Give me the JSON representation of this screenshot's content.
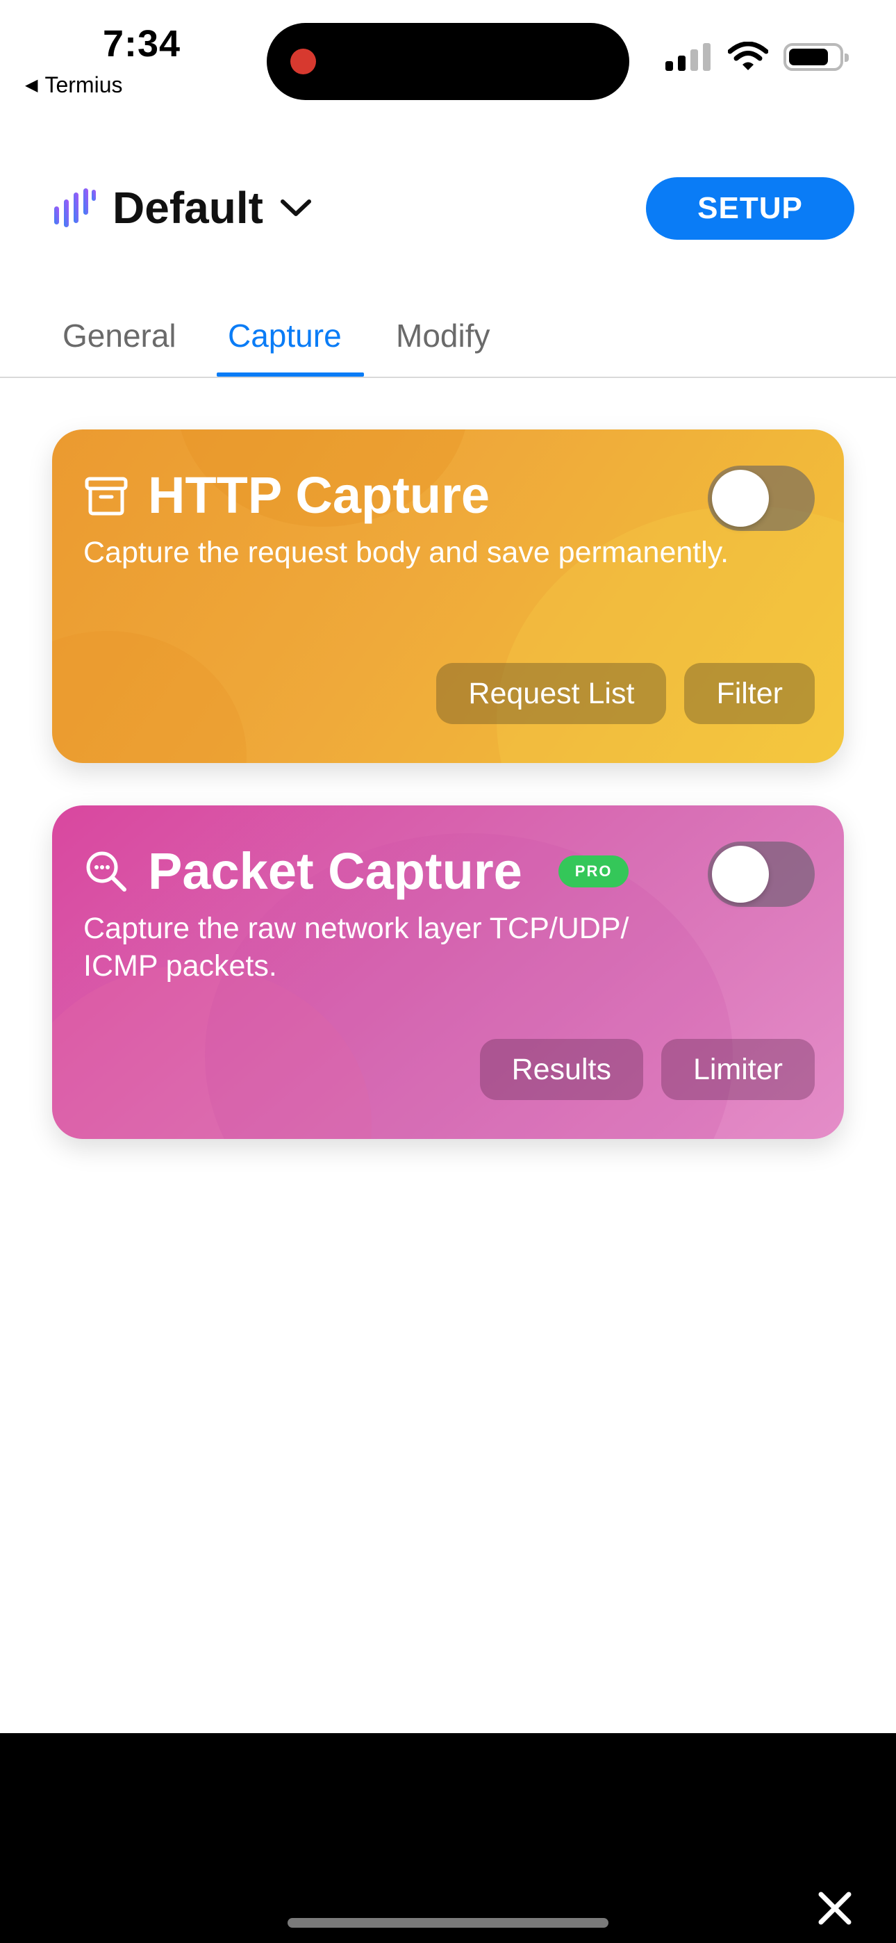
{
  "status_bar": {
    "time": "7:34",
    "back_app": "Termius"
  },
  "header": {
    "profile_name": "Default",
    "setup_label": "SETUP"
  },
  "tabs": [
    {
      "label": "General",
      "active": false
    },
    {
      "label": "Capture",
      "active": true
    },
    {
      "label": "Modify",
      "active": false
    }
  ],
  "cards": {
    "http": {
      "title": "HTTP Capture",
      "description": "Capture the request body and save permanently.",
      "enabled": false,
      "actions": [
        "Request List",
        "Filter"
      ],
      "icon": "archive-box-icon"
    },
    "packet": {
      "title": "Packet Capture",
      "badge": "PRO",
      "description": "Capture the raw network layer TCP/UDP/ ICMP packets.",
      "enabled": false,
      "actions": [
        "Results",
        "Limiter"
      ],
      "icon": "search-dots-icon"
    }
  },
  "colors": {
    "accent": "#0a7cf6",
    "http_card": "#efa93a",
    "packet_card": "#d870b6",
    "pro_badge": "#34c759"
  }
}
